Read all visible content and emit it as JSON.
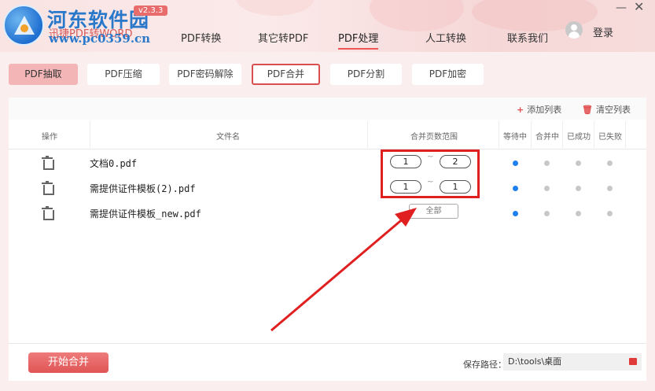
{
  "header": {
    "watermark_cn": "河东软件园",
    "watermark_url": "www.pc0359.cn",
    "app_title": "迅捷PDF转WORD",
    "version": "v2.3.3",
    "login_label": "登录",
    "minimize_glyph": "—",
    "close_glyph": "✕"
  },
  "nav": {
    "items": [
      "PDF转换",
      "其它转PDF",
      "PDF处理",
      "人工转换",
      "联系我们"
    ],
    "active": "PDF处理"
  },
  "subtabs": [
    "PDF抽取",
    "PDF压缩",
    "PDF密码解除",
    "PDF合并",
    "PDF分割",
    "PDF加密"
  ],
  "toolbar": {
    "add_list": "添加列表",
    "clear_list": "清空列表"
  },
  "table": {
    "headers": {
      "action": "操作",
      "filename": "文件名",
      "range": "合并页数范围",
      "waiting": "等待中",
      "merging": "合并中",
      "success": "已成功",
      "failed": "已失败"
    },
    "rows": [
      {
        "filename": "文档0.pdf",
        "range_from": "1",
        "range_to": "2",
        "range_all": "",
        "status": "waiting"
      },
      {
        "filename": "需提供证件模板(2).pdf",
        "range_from": "1",
        "range_to": "1",
        "range_all": "",
        "status": "waiting"
      },
      {
        "filename": "需提供证件模板_new.pdf",
        "range_from": "",
        "range_to": "",
        "range_all": "全部",
        "status": "waiting"
      }
    ],
    "range_separator": "~"
  },
  "footer": {
    "start_button": "开始合并",
    "save_path_label": "保存路径：",
    "save_path_value": "D:\\tools\\桌面"
  },
  "colors": {
    "accent": "#e05555",
    "status_blue": "#1f7ff0",
    "annotation_red": "#e02020"
  }
}
